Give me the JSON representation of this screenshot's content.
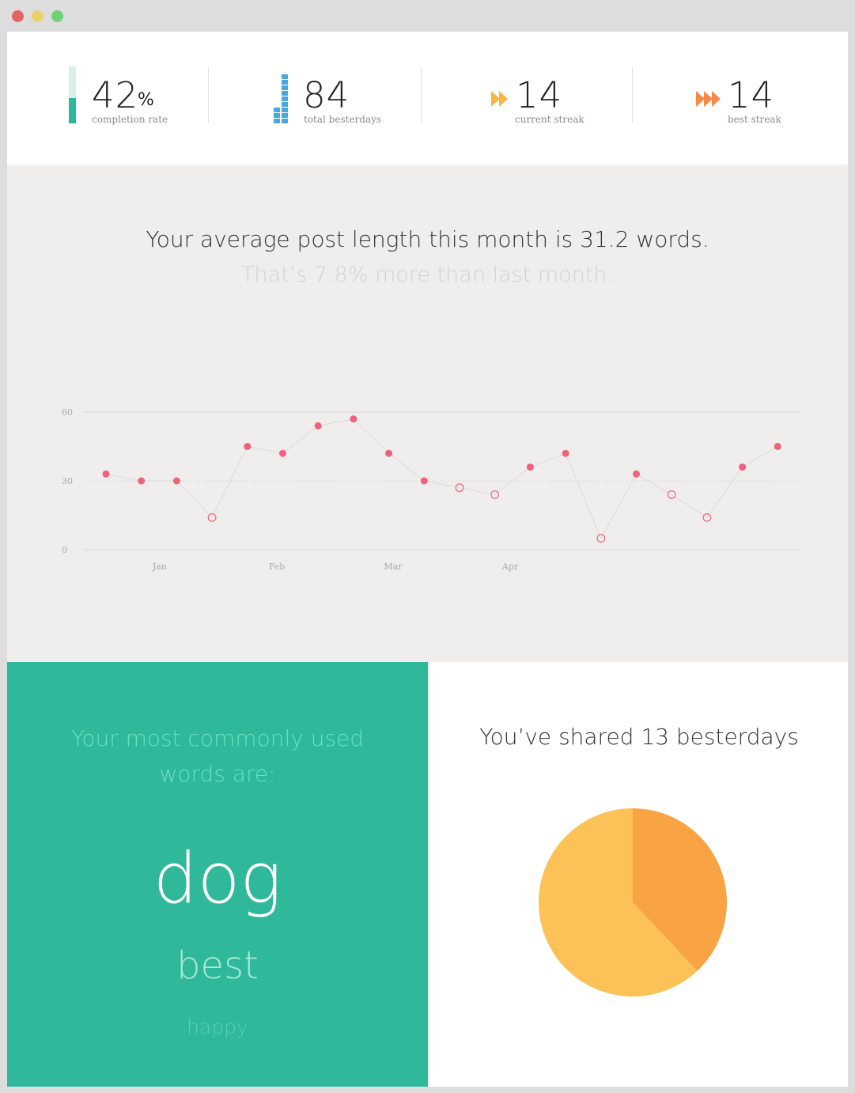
{
  "window": {
    "controls": [
      "close",
      "minimize",
      "maximize"
    ],
    "colors": {
      "close": "#e0645f",
      "minimize": "#e7d26a",
      "maximize": "#6ed275"
    }
  },
  "stats": {
    "completion": {
      "value": "42",
      "unit": "%",
      "label": "completion rate",
      "fraction": 0.42,
      "color": "#2fb799"
    },
    "total": {
      "value": "84",
      "label": "total besterdays",
      "icon": "bar-stack-icon",
      "color": "#47a9df"
    },
    "current_streak": {
      "value": "14",
      "label": "current streak",
      "icon": "double-arrow-icon",
      "color": "#f8b544"
    },
    "best_streak": {
      "value": "14",
      "label": "best streak",
      "icon": "triple-arrow-icon",
      "color": "#f8894b"
    }
  },
  "post_length": {
    "headline": "Your average post length this month is 31.2 words.",
    "subheadline": "That’s 7.8% more than last month."
  },
  "chart_data": {
    "type": "line",
    "title": "",
    "xlabel": "",
    "ylabel": "",
    "ylim": [
      0,
      60
    ],
    "yticks": [
      "0",
      "30",
      "60"
    ],
    "month_labels": [
      "Jan",
      "Feb",
      "Mar",
      "Apr"
    ],
    "average_line": 30,
    "grid": "horizontal lines at 0 and 60, dotted line at 30",
    "series": [
      {
        "values": [
          33,
          30,
          30,
          14,
          45,
          42,
          54,
          57,
          42,
          30,
          27,
          24,
          36,
          42,
          5,
          33,
          24,
          14,
          36,
          45
        ],
        "above_average_color": "#f0617d",
        "below_average_style": "hollow pink circles"
      }
    ]
  },
  "words": {
    "heading": "Your most commonly used words are:",
    "list": [
      "dog",
      "best",
      "happy"
    ]
  },
  "shared": {
    "heading": "You’ve shared 13 besterdays",
    "chart_data": {
      "type": "pie",
      "slices": [
        {
          "value": 38,
          "color": "#f8a444"
        },
        {
          "value": 62,
          "color": "#fdc257"
        }
      ]
    }
  }
}
